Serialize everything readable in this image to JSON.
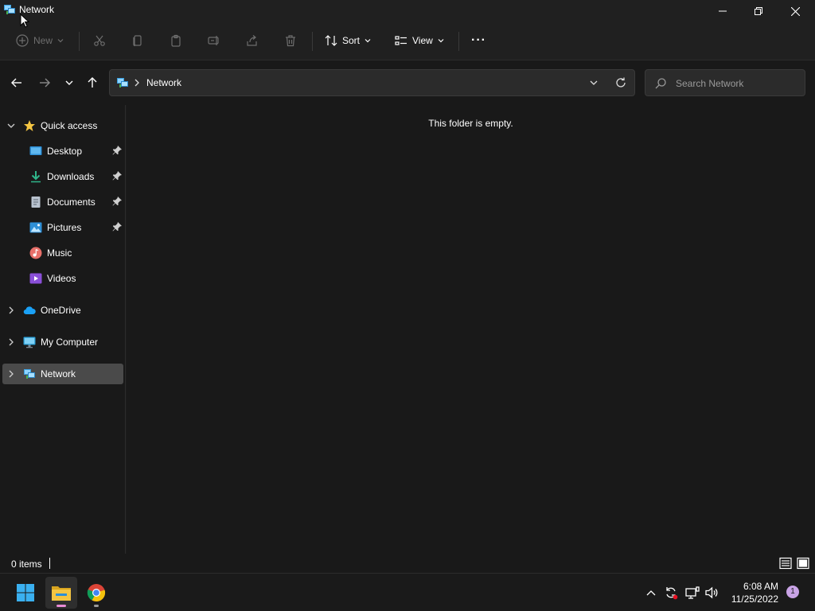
{
  "window": {
    "title": "Network"
  },
  "commandbar": {
    "new_label": "New",
    "sort_label": "Sort",
    "view_label": "View",
    "more_label": "···"
  },
  "address": {
    "path": "Network",
    "search_placeholder": "Search Network"
  },
  "sidebar": {
    "items": [
      {
        "label": "Quick access",
        "icon": "star-icon"
      },
      {
        "label": "Desktop",
        "icon": "desktop-icon",
        "pinned": true
      },
      {
        "label": "Downloads",
        "icon": "download-icon",
        "pinned": true
      },
      {
        "label": "Documents",
        "icon": "documents-icon",
        "pinned": true
      },
      {
        "label": "Pictures",
        "icon": "pictures-icon",
        "pinned": true
      },
      {
        "label": "Music",
        "icon": "music-icon"
      },
      {
        "label": "Videos",
        "icon": "videos-icon"
      },
      {
        "label": "OneDrive",
        "icon": "onedrive-icon"
      },
      {
        "label": "My Computer",
        "icon": "computer-icon"
      },
      {
        "label": "Network",
        "icon": "network-icon",
        "selected": true
      }
    ]
  },
  "content": {
    "empty_message": "This folder is empty."
  },
  "status": {
    "item_count": "0 items"
  },
  "taskbar": {
    "time": "6:08 AM",
    "date": "11/25/2022",
    "notification_count": "1"
  },
  "colors": {
    "background": "#191919",
    "titlebar": "#202020",
    "selected": "#4a4a4a",
    "folder_yellow": "#f4c542",
    "accent_blue": "#1aa0f5",
    "notification": "#c9a3e6"
  }
}
